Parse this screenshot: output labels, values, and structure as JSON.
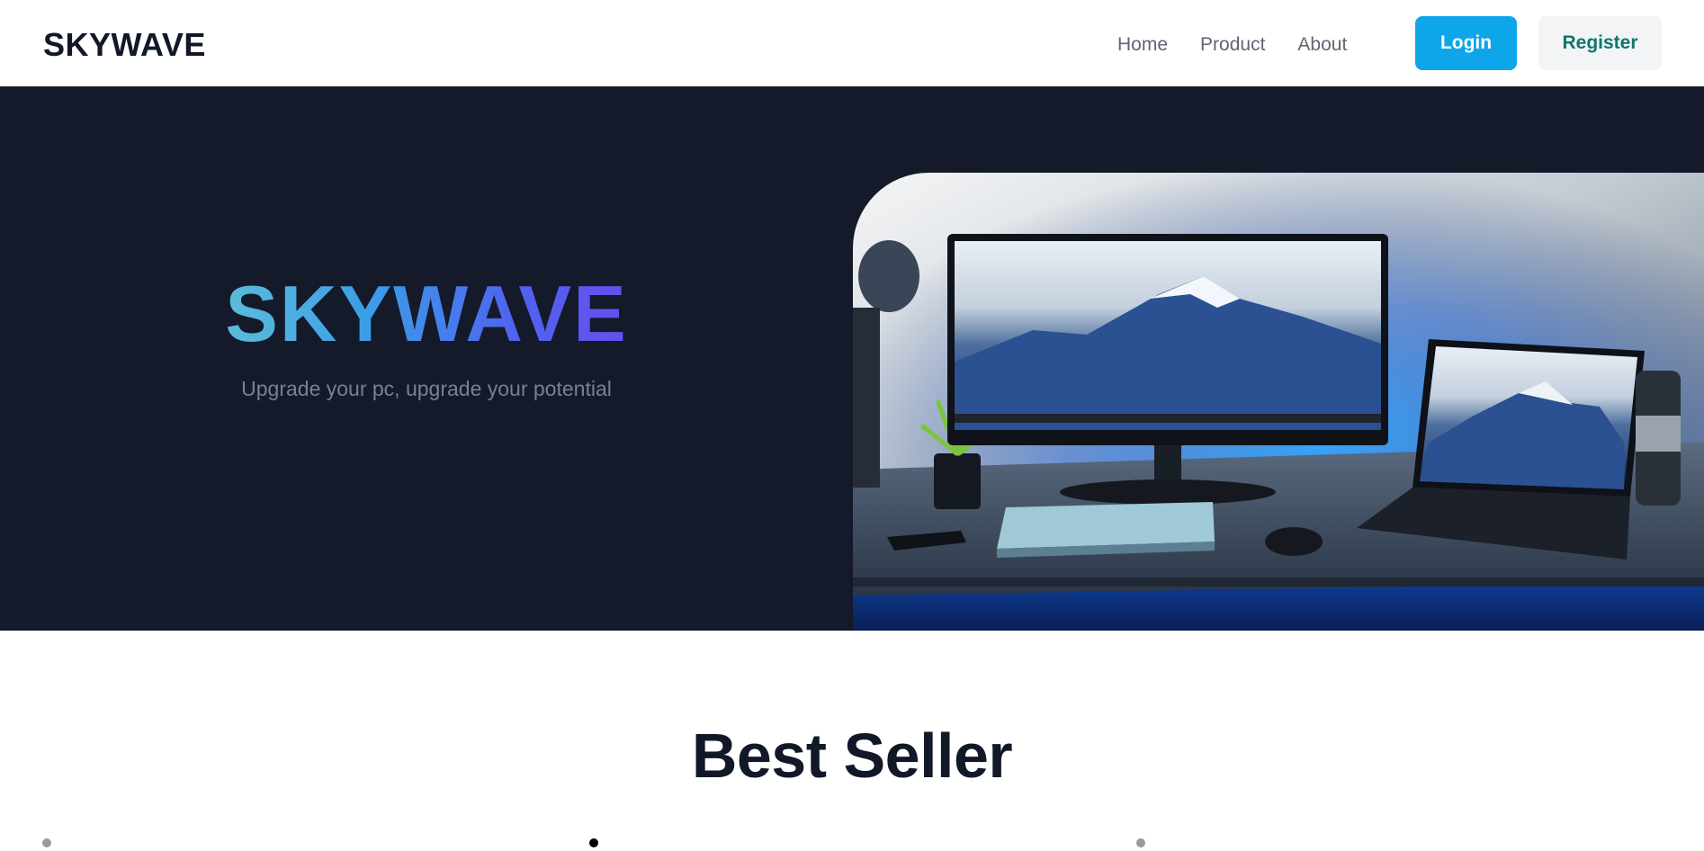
{
  "navbar": {
    "brand": "SKYWAVE",
    "links": [
      {
        "label": "Home"
      },
      {
        "label": "Product"
      },
      {
        "label": "About"
      }
    ],
    "login_label": "Login",
    "register_label": "Register"
  },
  "hero": {
    "title": "SKYWAVE",
    "subtitle": "Upgrade your pc, upgrade your potential",
    "image": "desk-setup-photo"
  },
  "best_seller": {
    "title": "Best Seller",
    "carousel_dots": 3,
    "active_dot": 2
  },
  "colors": {
    "hero_background": "#141a29",
    "login_button": "#0ea5e9",
    "register_text": "#0f766e",
    "title_gradient_start": "#67c5d4",
    "title_gradient_end": "#7045ee"
  }
}
